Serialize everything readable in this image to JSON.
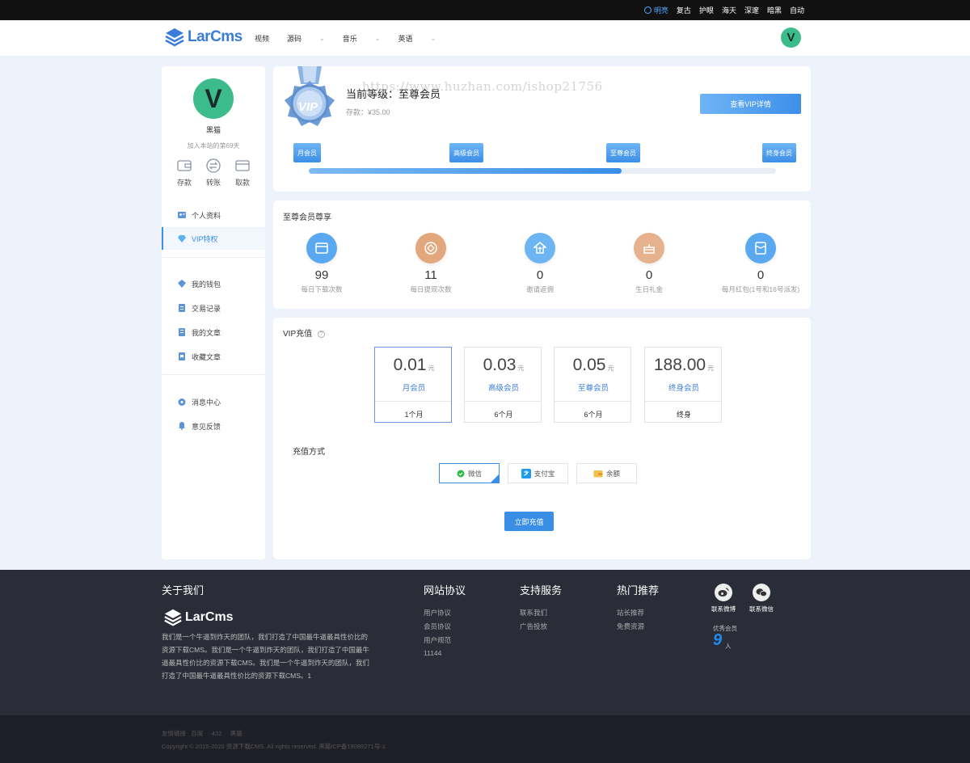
{
  "topbar": {
    "themes": [
      {
        "label": "明亮",
        "active": true
      },
      {
        "label": "复古",
        "active": false
      },
      {
        "label": "护眼",
        "active": false
      },
      {
        "label": "海天",
        "active": false
      },
      {
        "label": "深邃",
        "active": false
      },
      {
        "label": "暗黑",
        "active": false
      },
      {
        "label": "自动",
        "active": false
      }
    ]
  },
  "header": {
    "logo_text": "LarCms",
    "nav": [
      {
        "label": "视频",
        "has_dropdown": false
      },
      {
        "label": "源码",
        "has_dropdown": true
      },
      {
        "label": "音乐",
        "has_dropdown": true
      },
      {
        "label": "英语",
        "has_dropdown": true
      }
    ],
    "avatar_letter": "V"
  },
  "sidebar": {
    "avatar_letter": "V",
    "username": "黑猫",
    "joined": "加入本站的第69天",
    "quick_actions": [
      {
        "label": "存款",
        "icon": "wallet-icon"
      },
      {
        "label": "转账",
        "icon": "transfer-icon"
      },
      {
        "label": "取款",
        "icon": "card-icon"
      }
    ],
    "menu_groups": [
      [
        {
          "label": "个人资料",
          "icon": "profile-icon",
          "active": false
        },
        {
          "label": "VIP特权",
          "icon": "diamond-icon",
          "active": true
        }
      ],
      [
        {
          "label": "我的钱包",
          "icon": "wallet-icon",
          "active": false
        },
        {
          "label": "交易记录",
          "icon": "record-icon",
          "active": false
        },
        {
          "label": "我的文章",
          "icon": "article-icon",
          "active": false
        },
        {
          "label": "收藏文章",
          "icon": "favorite-icon",
          "active": false
        }
      ],
      [
        {
          "label": "消息中心",
          "icon": "message-icon",
          "active": false
        },
        {
          "label": "意见反馈",
          "icon": "bell-icon",
          "active": false
        }
      ]
    ]
  },
  "level": {
    "badge_text": "VIP",
    "title": "当前等级：至尊会员",
    "balance": "存款：¥35.00",
    "detail_button": "查看VIP详情",
    "tiers": [
      "月会员",
      "高级会员",
      "至尊会员",
      "终身会员"
    ],
    "progress_fraction": 0.67
  },
  "watermark": "https://www.huzhan.com/ishop21756",
  "privileges": {
    "title": "至尊会员尊享",
    "items": [
      {
        "value": "99",
        "label": "每日下载次数",
        "icon": "download-icon",
        "color": "#5aa8f0"
      },
      {
        "value": "11",
        "label": "每日提现次数",
        "icon": "withdraw-icon",
        "color": "#e2a77c"
      },
      {
        "value": "0",
        "label": "邀请返佣",
        "icon": "invite-icon",
        "color": "#6cb4f2"
      },
      {
        "value": "0",
        "label": "生日礼金",
        "icon": "cake-icon",
        "color": "#e6b18d"
      },
      {
        "value": "0",
        "label": "每月红包(1号和16号派发)",
        "icon": "redpacket-icon",
        "color": "#5aa8f0"
      }
    ]
  },
  "recharge": {
    "title": "VIP充值",
    "currency": "元",
    "plans": [
      {
        "price": "0.01",
        "name": "月会员",
        "duration": "1个月",
        "selected": true
      },
      {
        "price": "0.03",
        "name": "高级会员",
        "duration": "6个月",
        "selected": false
      },
      {
        "price": "0.05",
        "name": "至尊会员",
        "duration": "6个月",
        "selected": false
      },
      {
        "price": "188.00",
        "name": "终身会员",
        "duration": "终身",
        "selected": false
      }
    ],
    "pay_label": "充值方式",
    "pay_methods": [
      {
        "label": "微信",
        "icon": "wechat-icon",
        "selected": true
      },
      {
        "label": "支付宝",
        "icon": "alipay-icon",
        "selected": false
      },
      {
        "label": "余额",
        "icon": "balance-icon",
        "selected": false
      }
    ],
    "submit": "立即充值"
  },
  "footer": {
    "about_title": "关于我们",
    "logo_text": "LarCms",
    "about_desc": "我们是一个牛逼到炸天的团队，我们打造了中国最牛逼最具性价比的资源下载CMS。我们是一个牛逼到炸天的团队，我们打造了中国最牛逼最具性价比的资源下载CMS。我们是一个牛逼到炸天的团队，我们打造了中国最牛逼最具性价比的资源下载CMS。1",
    "columns": [
      {
        "title": "网站协议",
        "links": [
          "用户协议",
          "会员协议",
          "用户规范",
          "11144"
        ]
      },
      {
        "title": "支持服务",
        "links": [
          "联系我们",
          "广告投放"
        ]
      },
      {
        "title": "热门推荐",
        "links": [
          "站长推荐",
          "免费资源"
        ]
      }
    ],
    "social": [
      {
        "label": "联系微博",
        "icon": "weibo-icon"
      },
      {
        "label": "联系微信",
        "icon": "wechat-icon"
      }
    ],
    "member_label": "优秀会员",
    "member_count": "9",
    "member_unit": "人",
    "friend_links": [
      "友情链接",
      "百度",
      "432",
      "黑猫"
    ],
    "copyright": "Copyright © 2015-2020 资源下载CMS. All rights reserved. 黑猫ICP备18089271号-1"
  }
}
